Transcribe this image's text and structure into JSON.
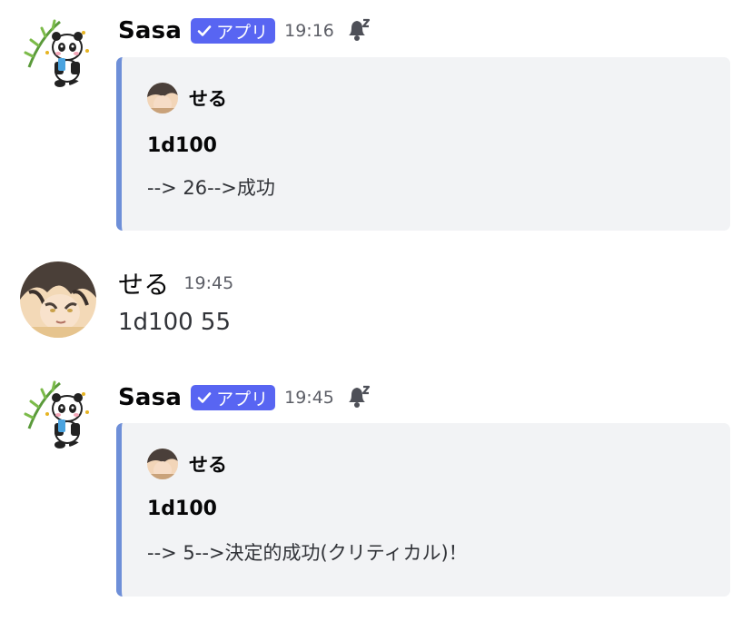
{
  "colors": {
    "badge": "#5865f2",
    "embed_border": "#6e8fd8",
    "embed_bg": "#f2f3f5",
    "timestamp": "#5c5e66"
  },
  "messages": [
    {
      "username": "Sasa",
      "badge": "アプリ",
      "time": "19:16",
      "icon": "bell-sleep-icon",
      "embed": {
        "author": "せる",
        "title": "1d100",
        "description": "--> 26-->成功"
      }
    },
    {
      "username": "せる",
      "time": "19:45",
      "content": "1d100 55"
    },
    {
      "username": "Sasa",
      "badge": "アプリ",
      "time": "19:45",
      "icon": "bell-sleep-icon",
      "embed": {
        "author": "せる",
        "title": "1d100",
        "description": "--> 5-->決定的成功(クリティカル)！"
      }
    }
  ]
}
